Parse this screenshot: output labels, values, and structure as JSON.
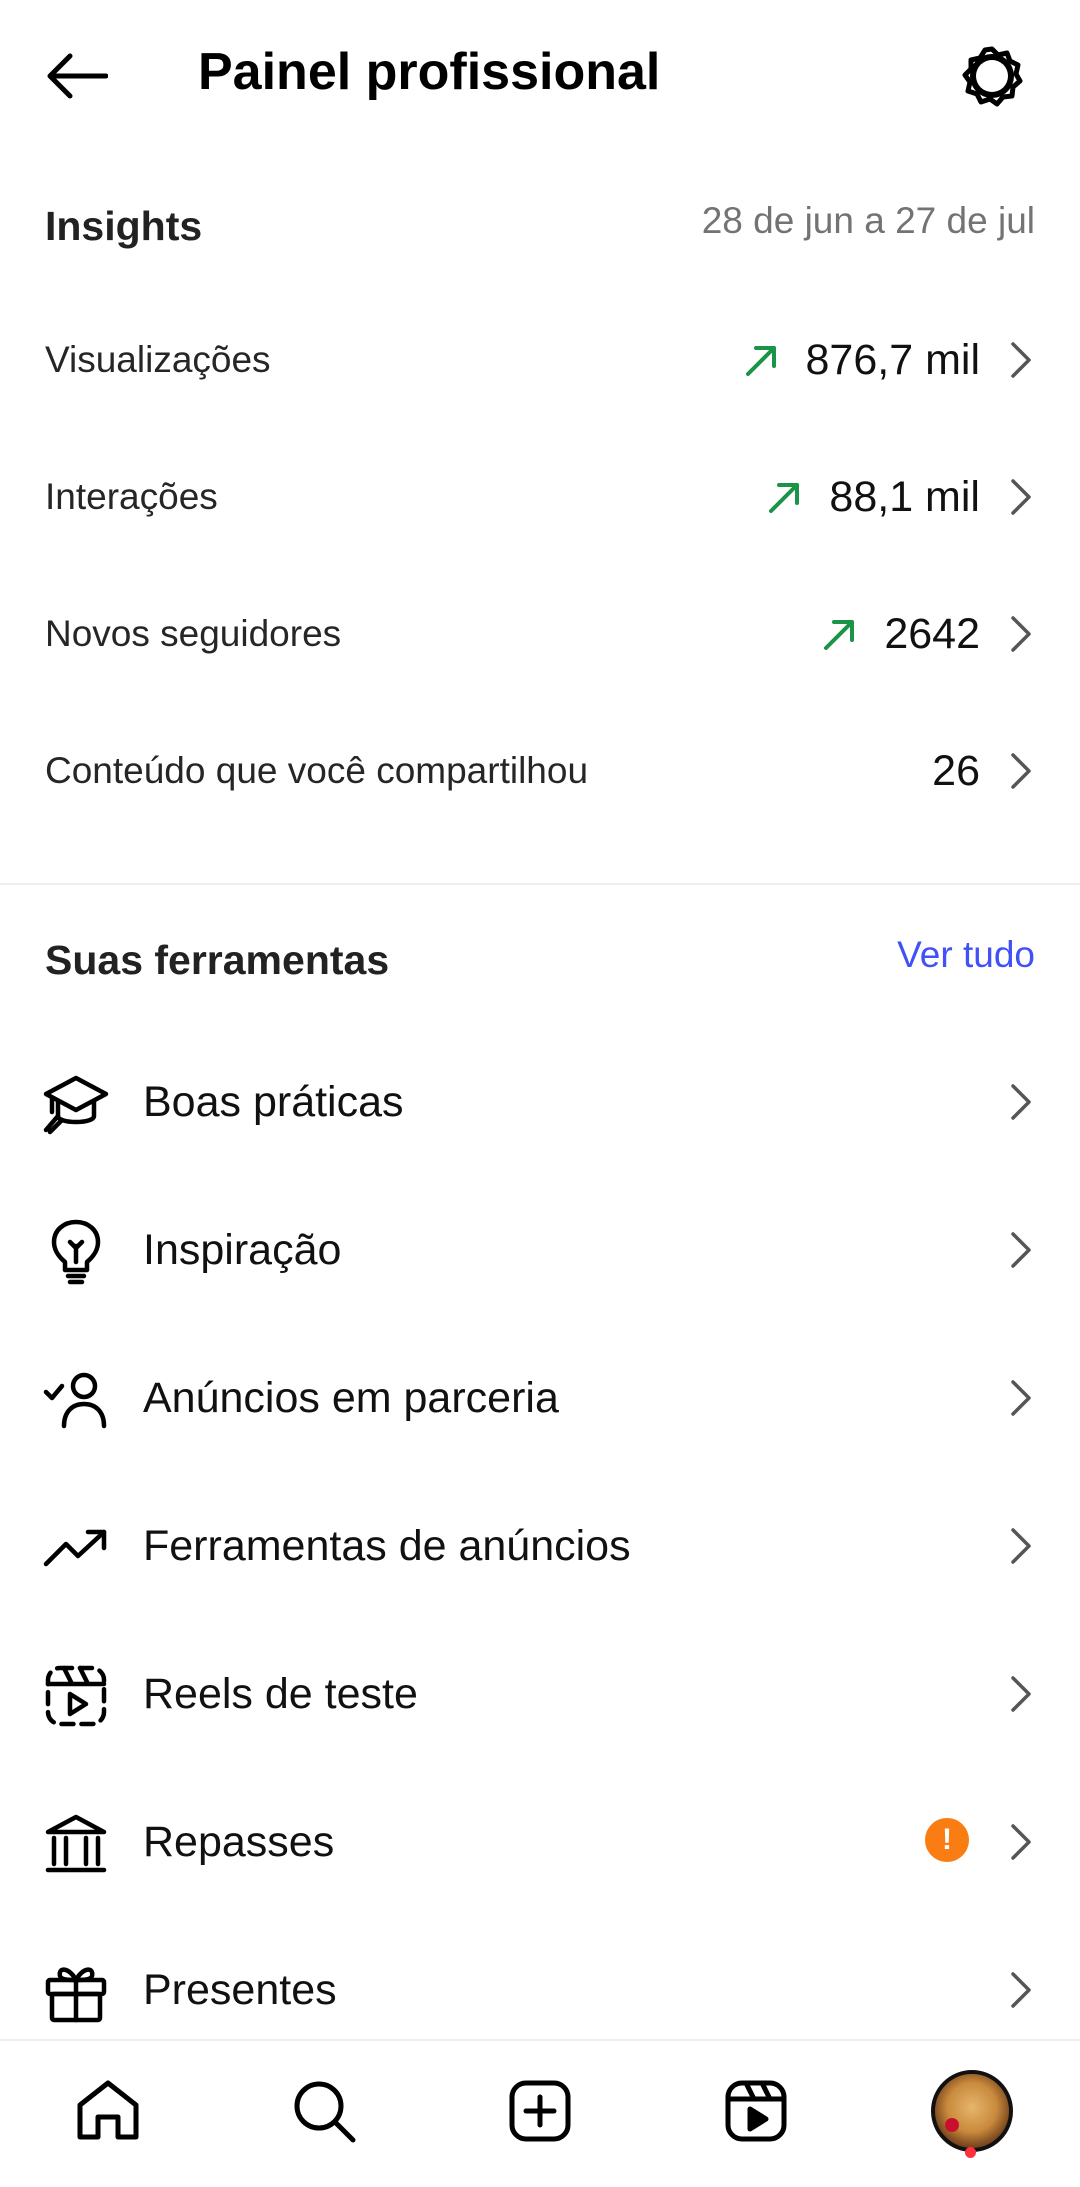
{
  "header": {
    "title": "Painel profissional",
    "back_icon": "arrow-left-icon",
    "settings_icon": "gear-icon"
  },
  "insights": {
    "title": "Insights",
    "date_range": "28 de jun a 27 de jul",
    "trend_color": "#1a9447",
    "metrics": [
      {
        "label": "Visualizações",
        "value": "876,7 mil",
        "trend": "up"
      },
      {
        "label": "Interações",
        "value": "88,1 mil",
        "trend": "up"
      },
      {
        "label": "Novos seguidores",
        "value": "2642",
        "trend": "up"
      },
      {
        "label": "Conteúdo que você compartilhou",
        "value": "26",
        "trend": "none"
      }
    ]
  },
  "tools": {
    "title": "Suas ferramentas",
    "see_all": "Ver tudo",
    "link_color": "#4150f7",
    "items": [
      {
        "label": "Boas práticas",
        "icon": "graduation-cap-icon"
      },
      {
        "label": "Inspiração",
        "icon": "lightbulb-icon"
      },
      {
        "label": "Anúncios em parceria",
        "icon": "partnership-ads-icon"
      },
      {
        "label": "Ferramentas de anúncios",
        "icon": "trending-up-icon"
      },
      {
        "label": "Reels de teste",
        "icon": "trial-reels-icon"
      },
      {
        "label": "Repasses",
        "icon": "bank-icon",
        "alert": "!"
      },
      {
        "label": "Presentes",
        "icon": "gift-icon"
      }
    ]
  },
  "bottom_nav": {
    "items": [
      "home-icon",
      "search-icon",
      "create-icon",
      "reels-icon",
      "profile-avatar"
    ]
  }
}
